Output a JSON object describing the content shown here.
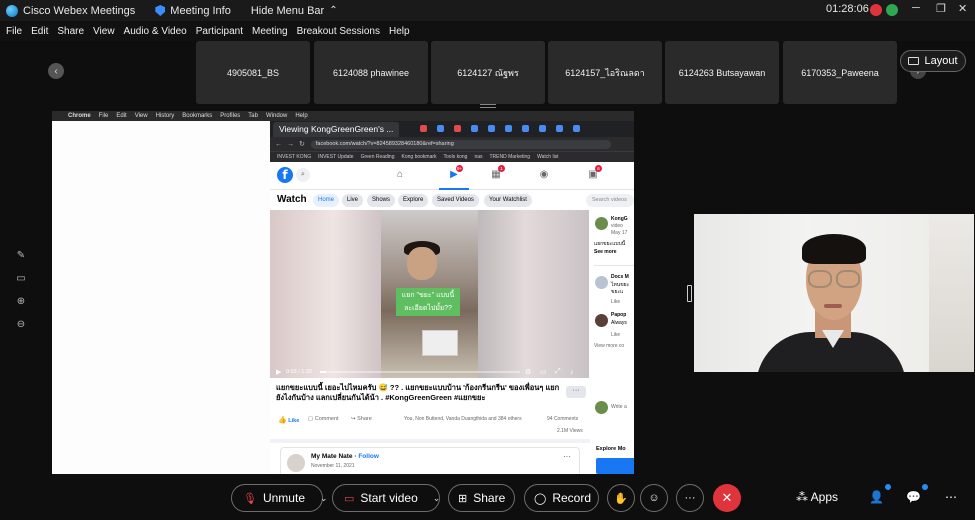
{
  "titlebar": {
    "app_title": "Cisco Webex Meetings",
    "meeting_info": "Meeting Info",
    "hide_menu_bar": "Hide Menu Bar",
    "clock": "01:28:06"
  },
  "menu": [
    "File",
    "Edit",
    "Share",
    "View",
    "Audio & Video",
    "Participant",
    "Meeting",
    "Breakout Sessions",
    "Help"
  ],
  "participants": [
    "4905081_BS",
    "6124088 phawinee",
    "6124127 ณัฐพร",
    "6124157_ไอริณลดา",
    "6124263 Butsayawan",
    "6170353_Paweena"
  ],
  "layout_label": "Layout",
  "shared_screen": {
    "mac_menu": [
      "Chrome",
      "File",
      "Edit",
      "View",
      "History",
      "Bookmarks",
      "Profiles",
      "Tab",
      "Window",
      "Help"
    ],
    "viewing_tab": "Viewing KongGreenGreen's ...",
    "url": "facebook.com/watch/?v=824589328460180&ref=sharing",
    "bookmarks": [
      "INVEST KONG",
      "INVEST Update",
      "Green Reading",
      "Kong bookmark",
      "Tools kong",
      "nas",
      "TREND Marketing",
      "Watch list"
    ],
    "fb": {
      "logo": "f",
      "watch_title": "Watch",
      "tabs": [
        "Home",
        "Live",
        "Shows",
        "Explore",
        "Saved Videos",
        "Your Watchlist"
      ],
      "search_placeholder": "Search videos",
      "badges": [
        "9+",
        "1",
        "6"
      ],
      "video_caption": "แยก \"ขยะ\" แบบนี้ ละเอียดไปมั้ย??",
      "video_time": "0:03 / 1:32",
      "video_progress": 0.03,
      "post_text": "แยกขยะแบบนี้ เยอะไปไหมครับ 😅 ?? . แยกขยะแบบบ้าน 'ก้องกรีนกรีน' ของเพื่อนๆ แยกยังไงกันบ้าง แลกเปลี่ยนกันได้น้า . #KongGreenGreen #แยกขยะ",
      "more": "···",
      "like": "Like",
      "comment": "Comment",
      "share": "Share",
      "reactions": "You, Non Buttend, Vanda Duangthida and 384 others",
      "comments_count": "94 Comments",
      "views": "2.1M Views",
      "card_name": "My Mate Nate",
      "card_follow": "Follow",
      "card_date": "November 11, 2021",
      "side": {
        "name": "KongG",
        "line1": "video",
        "line2": "May 17",
        "line3": "แยกขยะแบบนี้",
        "see_more": "See more",
        "c1a": "Docs M",
        "c1b": "ไหนขยะ",
        "c1c": "ขยะแ",
        "like1": "Like",
        "c2a": "Papop",
        "c2b": "Always",
        "like2": "Like",
        "view_more": "View more co",
        "write": "Write a",
        "explore": "Explore Mo"
      }
    }
  },
  "controls": {
    "unmute": "Unmute",
    "start_video": "Start video",
    "share": "Share",
    "record": "Record",
    "more": "···",
    "apps": "Apps"
  }
}
